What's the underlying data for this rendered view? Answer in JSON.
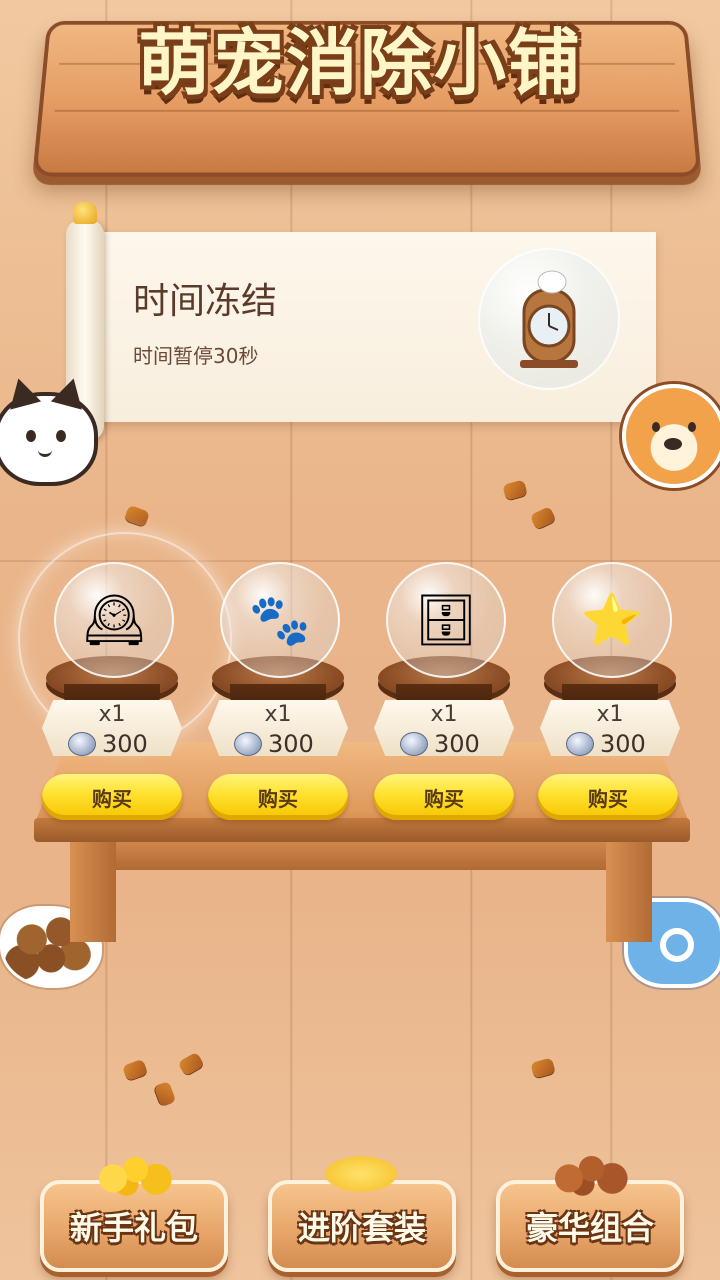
{
  "header": {
    "title": "萌宠消除小铺"
  },
  "featured": {
    "name": "时间冻结",
    "description": "时间暂停30秒",
    "icon": "cat-on-clock-icon"
  },
  "shop": {
    "currency_icon": "silver-coin-icon",
    "items": [
      {
        "icon": "cat-on-clock-icon",
        "glyph": "🕰",
        "quantity": "x1",
        "price": "300",
        "buy_label": "购买",
        "selected": true
      },
      {
        "icon": "paw-prints-stars-icon",
        "glyph": "🐾",
        "quantity": "x1",
        "price": "300",
        "buy_label": "购买",
        "selected": false
      },
      {
        "icon": "pet-shelf-icon",
        "glyph": "🗄",
        "quantity": "x1",
        "price": "300",
        "buy_label": "购买",
        "selected": false
      },
      {
        "icon": "smiling-star-x2-icon",
        "glyph": "⭐",
        "quantity": "x1",
        "price": "300",
        "buy_label": "购买",
        "selected": false
      }
    ]
  },
  "bundles": [
    {
      "label": "新手礼包",
      "icon": "gold-nuggets-icon"
    },
    {
      "label": "进阶套装",
      "icon": "cheese-icon"
    },
    {
      "label": "豪华组合",
      "icon": "kibble-pile-icon"
    }
  ],
  "colors": {
    "accent_yellow": "#ffe02e",
    "wood": "#e09a5c",
    "title_text": "#fff6c8"
  }
}
